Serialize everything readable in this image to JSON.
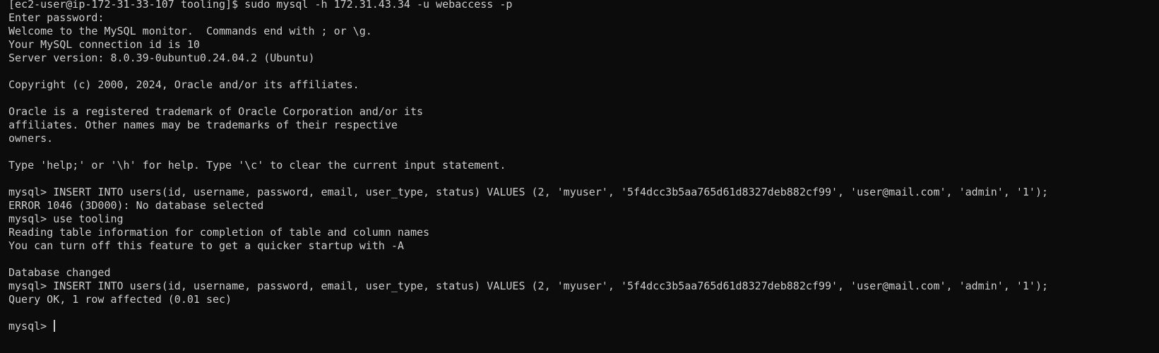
{
  "terminal": {
    "lines": [
      "[ec2-user@ip-172-31-33-107 tooling]$ sudo mysql -h 172.31.43.34 -u webaccess -p",
      "Enter password:",
      "Welcome to the MySQL monitor.  Commands end with ; or \\g.",
      "Your MySQL connection id is 10",
      "Server version: 8.0.39-0ubuntu0.24.04.2 (Ubuntu)",
      "",
      "Copyright (c) 2000, 2024, Oracle and/or its affiliates.",
      "",
      "Oracle is a registered trademark of Oracle Corporation and/or its",
      "affiliates. Other names may be trademarks of their respective",
      "owners.",
      "",
      "Type 'help;' or '\\h' for help. Type '\\c' to clear the current input statement.",
      "",
      "mysql> INSERT INTO users(id, username, password, email, user_type, status) VALUES (2, 'myuser', '5f4dcc3b5aa765d61d8327deb882cf99', 'user@mail.com', 'admin', '1');",
      "ERROR 1046 (3D000): No database selected",
      "mysql> use tooling",
      "Reading table information for completion of table and column names",
      "You can turn off this feature to get a quicker startup with -A",
      "",
      "Database changed",
      "mysql> INSERT INTO users(id, username, password, email, user_type, status) VALUES (2, 'myuser', '5f4dcc3b5aa765d61d8327deb882cf99', 'user@mail.com', 'admin', '1');",
      "Query OK, 1 row affected (0.01 sec)",
      ""
    ],
    "prompt": "mysql> "
  }
}
